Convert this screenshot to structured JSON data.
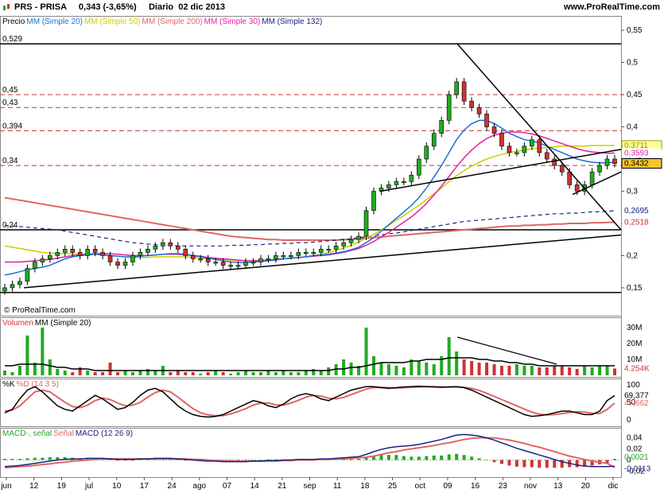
{
  "header": {
    "ticker": "PRS",
    "name": "PRISA",
    "last": "0,343 (-3,65%)",
    "period": "Diario",
    "date": "02 dic 2013",
    "site": "www.ProRealTime.com",
    "copyright": "© ProRealTime.com"
  },
  "legend_price": [
    {
      "text": "Precio",
      "color": "#000000"
    },
    {
      "text": "MM (Simple 20)",
      "color": "#1e6fd9"
    },
    {
      "text": "MM (Simple 50)",
      "color": "#cccc00"
    },
    {
      "text": "MM (Simple 200)",
      "color": "#e06666"
    },
    {
      "text": "MM (Simple 30)",
      "color": "#e020a0"
    },
    {
      "text": "MM (Simple 132)",
      "color": "#1a237e"
    }
  ],
  "legend_volume": [
    {
      "text": "Volumen",
      "color": "#cc3333"
    },
    {
      "text": "MM (Simple 20)",
      "color": "#000000"
    }
  ],
  "legend_stoch": [
    {
      "text": "%K",
      "color": "#000000"
    },
    {
      "text": "%D (14 3 5)",
      "color": "#e06666"
    }
  ],
  "legend_macd": [
    {
      "text": "MACD-, señal",
      "color": "#22aa22"
    },
    {
      "text": "Señal",
      "color": "#e06666"
    },
    {
      "text": "MACD (12 26 9)",
      "color": "#1a237e"
    }
  ],
  "price_levels_left": [
    "0,529",
    "0,45",
    "0,43",
    "0,394",
    "0,34",
    "0,24"
  ],
  "value_boxes": [
    {
      "text": "0,3711",
      "bg": "#ffff99",
      "color": "#999900"
    },
    {
      "text": "0,3593",
      "bg": "#ffffff",
      "color": "#e020a0"
    },
    {
      "text": "0,3432",
      "bg": "#f4c430",
      "color": "#000000"
    },
    {
      "text": "0,2695",
      "bg": "#ffffff",
      "color": "#1a237e"
    },
    {
      "text": "0,2518",
      "bg": "#ffffff",
      "color": "#cc3333"
    }
  ],
  "volume_box": {
    "text": "4.254K",
    "color": "#cc3333"
  },
  "stoch_boxes": [
    {
      "text": "69,377",
      "color": "#000000"
    },
    {
      "text": "47,662",
      "color": "#e06666"
    }
  ],
  "macd_boxes": [
    {
      "text": "0,0021",
      "color": "#22aa22"
    },
    {
      "text": "-0,0113",
      "color": "#1a237e"
    }
  ],
  "chart_data": {
    "type": "line",
    "title": "PRS - PRISA Diario 02 dic 2013",
    "x_tick_labels": [
      "jun",
      "12",
      "19",
      "jul",
      "10",
      "17",
      "24",
      "ago",
      "07",
      "14",
      "21",
      "sep",
      "11",
      "18",
      "25",
      "oct",
      "09",
      "16",
      "23",
      "nov",
      "13",
      "20",
      "dic"
    ],
    "price_axis_labels": [
      "0,55",
      "0,5",
      "0,45",
      "0,4",
      "0,35",
      "0,3",
      "0,25",
      "0,2",
      "0,15"
    ],
    "volume_axis_labels": [
      "30M",
      "20M",
      "10M"
    ],
    "stoch_axis_labels": [
      "100",
      "50",
      "0"
    ],
    "macd_axis_labels": [
      "0,04",
      "0,02",
      "0",
      "-0,02"
    ],
    "ylim_price": [
      0.14,
      0.56
    ],
    "close": [
      0.15,
      0.155,
      0.16,
      0.18,
      0.19,
      0.195,
      0.2,
      0.205,
      0.21,
      0.205,
      0.2,
      0.21,
      0.205,
      0.2,
      0.19,
      0.185,
      0.19,
      0.2,
      0.205,
      0.21,
      0.215,
      0.22,
      0.215,
      0.21,
      0.2,
      0.195,
      0.195,
      0.19,
      0.19,
      0.185,
      0.185,
      0.185,
      0.19,
      0.19,
      0.195,
      0.195,
      0.2,
      0.2,
      0.2,
      0.205,
      0.205,
      0.205,
      0.21,
      0.21,
      0.215,
      0.22,
      0.225,
      0.23,
      0.27,
      0.3,
      0.305,
      0.31,
      0.315,
      0.315,
      0.325,
      0.35,
      0.37,
      0.39,
      0.41,
      0.45,
      0.47,
      0.44,
      0.43,
      0.42,
      0.4,
      0.39,
      0.37,
      0.36,
      0.36,
      0.37,
      0.38,
      0.36,
      0.35,
      0.34,
      0.33,
      0.31,
      0.3,
      0.31,
      0.33,
      0.34,
      0.35,
      0.343
    ],
    "sma20": [
      0.17,
      0.172,
      0.175,
      0.178,
      0.18,
      0.182,
      0.185,
      0.19,
      0.195,
      0.198,
      0.2,
      0.201,
      0.202,
      0.201,
      0.2,
      0.199,
      0.198,
      0.198,
      0.199,
      0.2,
      0.201,
      0.202,
      0.203,
      0.203,
      0.202,
      0.2,
      0.198,
      0.196,
      0.194,
      0.192,
      0.19,
      0.189,
      0.189,
      0.19,
      0.191,
      0.192,
      0.193,
      0.195,
      0.196,
      0.197,
      0.198,
      0.2,
      0.201,
      0.202,
      0.204,
      0.206,
      0.209,
      0.213,
      0.22,
      0.228,
      0.238,
      0.248,
      0.258,
      0.268,
      0.278,
      0.29,
      0.305,
      0.322,
      0.34,
      0.36,
      0.38,
      0.395,
      0.405,
      0.41,
      0.41,
      0.405,
      0.398,
      0.39,
      0.385,
      0.38,
      0.378,
      0.375,
      0.37,
      0.365,
      0.36,
      0.355,
      0.35,
      0.347,
      0.345,
      0.344,
      0.344,
      0.345
    ],
    "sma50": [
      0.215,
      0.213,
      0.211,
      0.209,
      0.207,
      0.205,
      0.204,
      0.203,
      0.203,
      0.203,
      0.202,
      0.202,
      0.202,
      0.201,
      0.2,
      0.199,
      0.198,
      0.197,
      0.197,
      0.197,
      0.198,
      0.198,
      0.198,
      0.198,
      0.198,
      0.197,
      0.196,
      0.195,
      0.195,
      0.194,
      0.193,
      0.192,
      0.192,
      0.192,
      0.193,
      0.193,
      0.194,
      0.195,
      0.196,
      0.197,
      0.198,
      0.2,
      0.202,
      0.205,
      0.208,
      0.212,
      0.216,
      0.221,
      0.227,
      0.233,
      0.24,
      0.247,
      0.255,
      0.262,
      0.27,
      0.278,
      0.287,
      0.296,
      0.305,
      0.315,
      0.324,
      0.332,
      0.339,
      0.345,
      0.35,
      0.354,
      0.357,
      0.36,
      0.362,
      0.364,
      0.366,
      0.367,
      0.368,
      0.369,
      0.37,
      0.37,
      0.37,
      0.37,
      0.371,
      0.371,
      0.371,
      0.3711
    ],
    "sma30": [
      0.19,
      0.19,
      0.19,
      0.191,
      0.192,
      0.193,
      0.194,
      0.196,
      0.198,
      0.2,
      0.201,
      0.202,
      0.203,
      0.203,
      0.203,
      0.202,
      0.201,
      0.2,
      0.2,
      0.2,
      0.201,
      0.202,
      0.202,
      0.202,
      0.201,
      0.2,
      0.199,
      0.197,
      0.196,
      0.195,
      0.194,
      0.193,
      0.192,
      0.192,
      0.192,
      0.193,
      0.194,
      0.195,
      0.196,
      0.197,
      0.198,
      0.199,
      0.2,
      0.201,
      0.203,
      0.205,
      0.208,
      0.211,
      0.216,
      0.222,
      0.229,
      0.236,
      0.244,
      0.252,
      0.26,
      0.27,
      0.281,
      0.294,
      0.308,
      0.323,
      0.338,
      0.352,
      0.364,
      0.374,
      0.382,
      0.387,
      0.39,
      0.392,
      0.392,
      0.391,
      0.389,
      0.386,
      0.382,
      0.378,
      0.374,
      0.37,
      0.366,
      0.363,
      0.361,
      0.36,
      0.359,
      0.3593
    ],
    "sma132": [
      0.247,
      0.246,
      0.245,
      0.244,
      0.243,
      0.242,
      0.241,
      0.24,
      0.238,
      0.236,
      0.234,
      0.232,
      0.23,
      0.228,
      0.226,
      0.224,
      0.222,
      0.22,
      0.219,
      0.218,
      0.217,
      0.216,
      0.216,
      0.215,
      0.215,
      0.215,
      0.215,
      0.215,
      0.215,
      0.215,
      0.216,
      0.216,
      0.216,
      0.217,
      0.217,
      0.218,
      0.218,
      0.219,
      0.219,
      0.22,
      0.22,
      0.221,
      0.222,
      0.223,
      0.224,
      0.225,
      0.226,
      0.228,
      0.229,
      0.231,
      0.232,
      0.234,
      0.235,
      0.237,
      0.239,
      0.241,
      0.243,
      0.245,
      0.247,
      0.249,
      0.251,
      0.253,
      0.254,
      0.255,
      0.256,
      0.257,
      0.258,
      0.259,
      0.26,
      0.261,
      0.262,
      0.263,
      0.264,
      0.265,
      0.265,
      0.266,
      0.266,
      0.267,
      0.268,
      0.268,
      0.269,
      0.2695
    ],
    "sma200": [
      0.29,
      0.288,
      0.286,
      0.284,
      0.282,
      0.28,
      0.278,
      0.276,
      0.274,
      0.272,
      0.27,
      0.268,
      0.266,
      0.264,
      0.262,
      0.26,
      0.258,
      0.256,
      0.254,
      0.252,
      0.25,
      0.248,
      0.246,
      0.244,
      0.242,
      0.24,
      0.238,
      0.236,
      0.234,
      0.232,
      0.23,
      0.229,
      0.228,
      0.227,
      0.226,
      0.225,
      0.225,
      0.224,
      0.224,
      0.224,
      0.224,
      0.224,
      0.224,
      0.224,
      0.224,
      0.225,
      0.225,
      0.226,
      0.227,
      0.228,
      0.229,
      0.23,
      0.231,
      0.232,
      0.233,
      0.234,
      0.235,
      0.236,
      0.237,
      0.238,
      0.239,
      0.24,
      0.241,
      0.242,
      0.243,
      0.244,
      0.245,
      0.246,
      0.246,
      0.247,
      0.247,
      0.248,
      0.248,
      0.249,
      0.249,
      0.25,
      0.25,
      0.25,
      0.251,
      0.251,
      0.2515,
      0.2518
    ],
    "horizontal_levels": [
      0.529,
      0.45,
      0.43,
      0.394,
      0.34,
      0.24
    ],
    "volume_M": [
      3,
      2,
      6,
      25,
      8,
      30,
      10,
      4,
      3,
      2,
      5,
      3,
      2,
      2,
      8,
      2,
      3,
      2,
      3,
      4,
      3,
      6,
      2,
      3,
      2,
      2,
      1,
      2,
      3,
      2,
      1,
      2,
      3,
      2,
      2,
      3,
      2,
      3,
      2,
      2,
      3,
      4,
      3,
      5,
      7,
      10,
      8,
      6,
      30,
      12,
      8,
      7,
      6,
      5,
      10,
      9,
      8,
      7,
      12,
      24,
      15,
      10,
      9,
      8,
      8,
      7,
      6,
      6,
      7,
      6,
      6,
      5,
      5,
      6,
      6,
      5,
      4,
      6,
      5,
      6,
      6,
      4.254
    ],
    "volume_sma20": [
      6,
      6,
      7,
      7,
      7,
      7,
      6,
      5,
      5,
      4,
      4,
      4,
      3,
      3,
      3,
      3,
      3,
      3,
      3,
      3,
      3,
      3,
      3,
      3,
      3,
      3,
      3,
      3,
      3,
      3,
      3,
      3,
      3,
      3,
      3,
      3,
      3,
      3,
      3,
      3,
      3,
      3,
      3,
      3,
      4,
      4,
      5,
      5,
      6,
      7,
      8,
      8,
      8,
      8,
      9,
      9,
      10,
      10,
      10,
      11,
      11,
      11,
      11,
      10,
      10,
      9,
      9,
      8,
      8,
      7,
      7,
      6,
      6,
      6,
      6,
      6,
      6,
      6,
      6,
      6,
      6,
      6
    ],
    "stoch_k": [
      20,
      30,
      60,
      85,
      95,
      80,
      60,
      40,
      30,
      25,
      40,
      55,
      70,
      60,
      45,
      30,
      35,
      50,
      70,
      85,
      90,
      80,
      60,
      40,
      25,
      15,
      10,
      8,
      10,
      15,
      25,
      35,
      45,
      55,
      50,
      40,
      35,
      45,
      60,
      70,
      75,
      70,
      60,
      55,
      65,
      75,
      85,
      90,
      95,
      95,
      92,
      90,
      92,
      94,
      95,
      96,
      95,
      94,
      93,
      94,
      95,
      92,
      85,
      75,
      65,
      55,
      45,
      35,
      25,
      15,
      10,
      12,
      15,
      20,
      25,
      25,
      20,
      15,
      15,
      25,
      55,
      69.377
    ],
    "stoch_d": [
      25,
      28,
      40,
      60,
      80,
      85,
      80,
      65,
      50,
      38,
      35,
      42,
      55,
      62,
      58,
      48,
      40,
      42,
      50,
      65,
      78,
      85,
      80,
      65,
      48,
      32,
      20,
      14,
      12,
      12,
      17,
      24,
      32,
      42,
      48,
      48,
      43,
      42,
      48,
      56,
      65,
      70,
      68,
      62,
      60,
      64,
      72,
      80,
      88,
      92,
      93,
      92,
      91,
      92,
      93,
      94,
      95,
      95,
      94,
      94,
      94,
      93,
      90,
      84,
      76,
      67,
      58,
      49,
      40,
      31,
      22,
      16,
      14,
      15,
      18,
      21,
      23,
      22,
      19,
      18,
      30,
      47.662
    ],
    "macd": [
      -0.012,
      -0.011,
      -0.01,
      -0.008,
      -0.006,
      -0.004,
      -0.002,
      0,
      0.001,
      0.002,
      0.002,
      0.003,
      0.003,
      0.003,
      0.002,
      0.001,
      0.001,
      0.001,
      0.002,
      0.002,
      0.003,
      0.003,
      0.003,
      0.002,
      0.001,
      0,
      -0.001,
      -0.002,
      -0.002,
      -0.003,
      -0.003,
      -0.003,
      -0.003,
      -0.002,
      -0.002,
      -0.001,
      -0.001,
      0,
      0,
      0.001,
      0.001,
      0.001,
      0.002,
      0.002,
      0.003,
      0.004,
      0.005,
      0.006,
      0.01,
      0.015,
      0.019,
      0.022,
      0.024,
      0.025,
      0.026,
      0.028,
      0.031,
      0.034,
      0.037,
      0.041,
      0.045,
      0.046,
      0.045,
      0.043,
      0.04,
      0.036,
      0.031,
      0.026,
      0.021,
      0.017,
      0.013,
      0.009,
      0.005,
      0.001,
      -0.003,
      -0.006,
      -0.009,
      -0.011,
      -0.012,
      -0.012,
      -0.012,
      -0.0113
    ],
    "macd_signal": [
      -0.014,
      -0.013,
      -0.012,
      -0.011,
      -0.01,
      -0.008,
      -0.007,
      -0.005,
      -0.004,
      -0.002,
      -0.001,
      0,
      0.001,
      0.002,
      0.002,
      0.002,
      0.002,
      0.002,
      0.002,
      0.002,
      0.002,
      0.002,
      0.002,
      0.002,
      0.002,
      0.001,
      0.001,
      0,
      -0.001,
      -0.001,
      -0.002,
      -0.002,
      -0.002,
      -0.002,
      -0.002,
      -0.002,
      -0.002,
      -0.001,
      -0.001,
      0,
      0,
      0,
      0.001,
      0.001,
      0.002,
      0.002,
      0.003,
      0.004,
      0.005,
      0.007,
      0.01,
      0.013,
      0.015,
      0.018,
      0.02,
      0.022,
      0.024,
      0.026,
      0.029,
      0.031,
      0.034,
      0.037,
      0.039,
      0.04,
      0.04,
      0.04,
      0.038,
      0.036,
      0.033,
      0.03,
      0.026,
      0.023,
      0.019,
      0.015,
      0.011,
      0.007,
      0.004,
      0.001,
      -0.002,
      -0.004,
      -0.006,
      -0.0134
    ]
  }
}
